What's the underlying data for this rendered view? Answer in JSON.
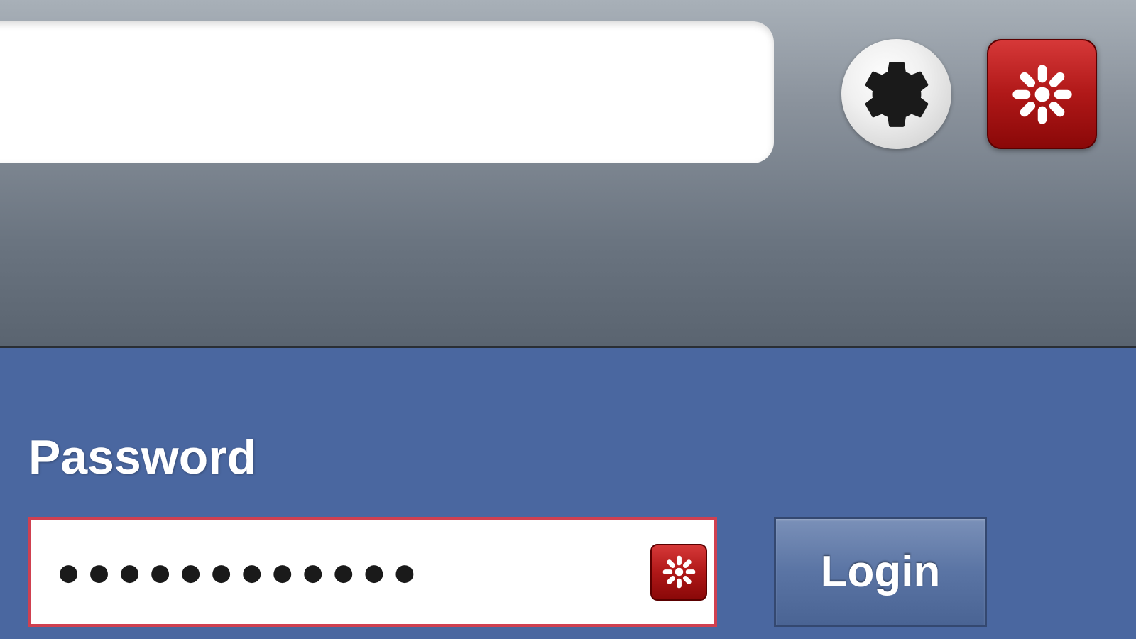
{
  "toolbar": {
    "address_value": "",
    "settings_icon": "gear-icon",
    "extension_icon": "lastpass-icon"
  },
  "login_form": {
    "password_label": "Password",
    "password_value": "●●●●●●●●●●●●",
    "login_button_label": "Login",
    "field_icon": "lastpass-icon"
  },
  "colors": {
    "toolbar_gradient_top": "#a8b0b8",
    "toolbar_gradient_bottom": "#5a6470",
    "page_bg": "#4a67a0",
    "lastpass_red": "#b01818",
    "field_border": "#d04050",
    "button_bg": "#5a74a4"
  }
}
